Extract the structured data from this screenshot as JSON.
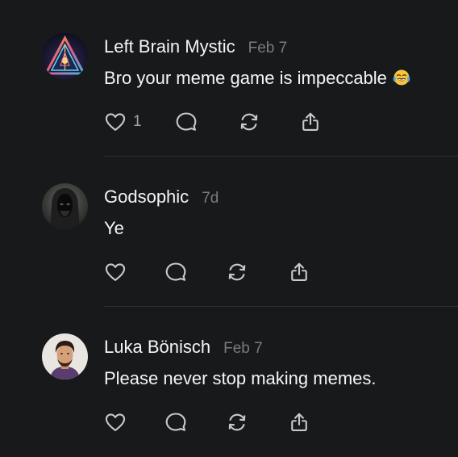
{
  "comments": [
    {
      "author": "Left Brain Mystic",
      "date": "Feb 7",
      "text": "Bro your meme game is impeccable",
      "emoji": "face-with-tears-of-joy",
      "likes": "1"
    },
    {
      "author": "Godsophic",
      "date": "7d",
      "text": "Ye",
      "likes": ""
    },
    {
      "author": "Luka Bönisch",
      "date": "Feb 7",
      "text": "Please never stop making memes.",
      "likes": ""
    }
  ],
  "icons": {
    "like": "heart-icon",
    "reply": "speech-bubble-icon",
    "repost": "repost-icon",
    "share": "share-icon"
  },
  "colors": {
    "background": "#18191b",
    "primary_text": "#f3f5f7",
    "secondary_text": "#7a7b80",
    "icon": "#c8c9cc",
    "divider": "#2e2f33"
  }
}
